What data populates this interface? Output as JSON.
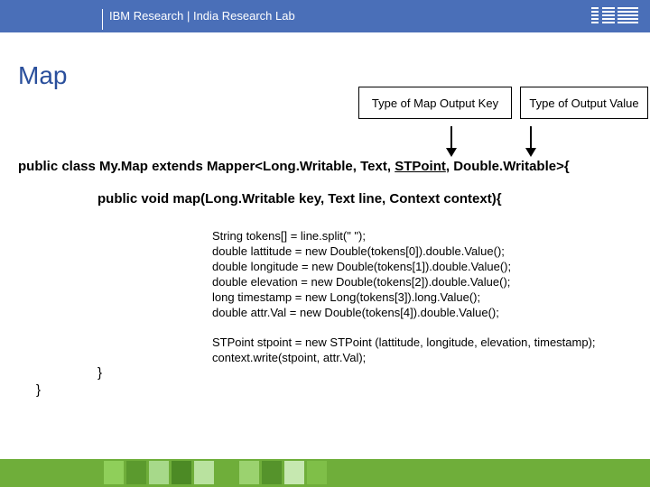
{
  "header": {
    "title": "IBM Research | India Research Lab",
    "logo_text": "IBM"
  },
  "slide": {
    "title": "Map",
    "callouts": {
      "key_label": "Type of Map Output Key",
      "value_label": "Type of Output Value"
    }
  },
  "code": {
    "class_prefix": "public class My.Map extends Mapper<Long.Writable, Text, ",
    "class_stpoint": "STPoint",
    "class_suffix": ", Double.Writable>{",
    "method_decl": "public void map(Long.Writable key, Text line, Context context){",
    "body": [
      "String tokens[] = line.split(\" \");",
      "double lattitude = new Double(tokens[0]).double.Value();",
      "double longitude = new Double(tokens[1]).double.Value();",
      "double elevation = new Double(tokens[2]).double.Value();",
      "long timestamp = new Long(tokens[3]).long.Value();",
      "double attr.Val = new Double(tokens[4]).double.Value();"
    ],
    "body2": [
      "STPoint stpoint = new STPoint (lattitude, longitude, elevation, timestamp);",
      "context.write(stpoint, attr.Val);"
    ],
    "method_close": "}",
    "class_close": "}"
  },
  "colors": {
    "header_bar": "#4a6fb8",
    "title": "#2a4f9c",
    "footer": "#6fae3a"
  }
}
